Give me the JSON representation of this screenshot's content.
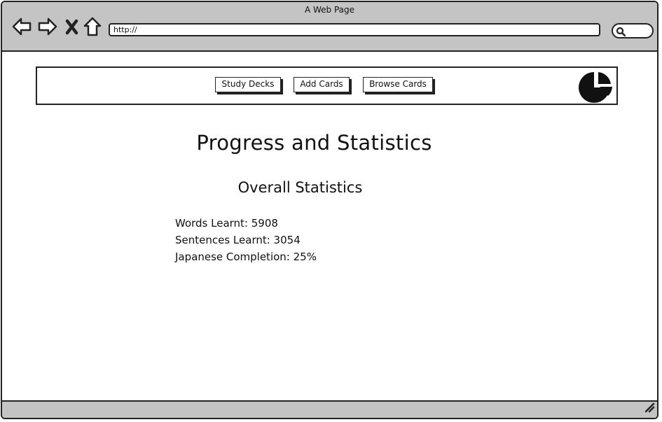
{
  "browser": {
    "window_title": "A Web Page",
    "url": "http://",
    "icons": {
      "back": "back-arrow-icon",
      "forward": "forward-arrow-icon",
      "stop": "close-x-icon",
      "home": "home-icon",
      "search": "search-icon",
      "resize": "resize-grip-icon"
    }
  },
  "navbar": {
    "buttons": [
      "Study Decks",
      "Add Cards",
      "Browse Cards"
    ],
    "logo_icon": "pie-chart-icon"
  },
  "main": {
    "title": "Progress and Statistics",
    "section_title": "Overall Statistics",
    "stats": [
      "Words Learnt: 5908",
      "Sentences Learnt: 3054",
      "Japanese Completion: 25%"
    ]
  }
}
